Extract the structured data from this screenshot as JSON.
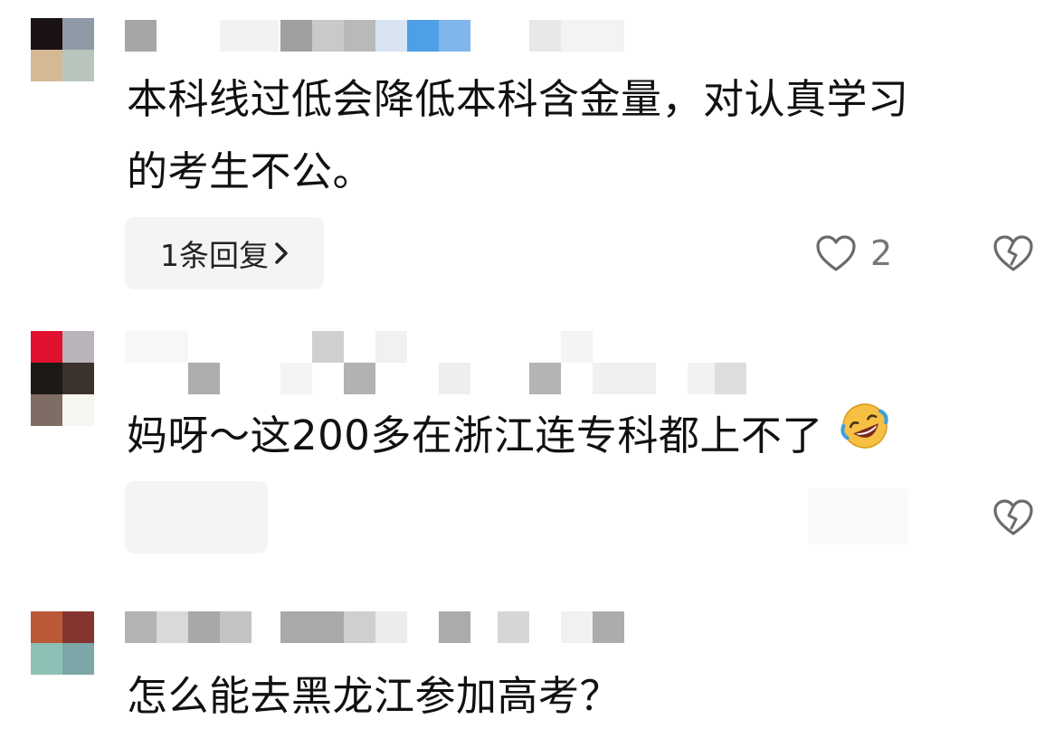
{
  "comments": [
    {
      "text_line1": "本科线过低会降低本科含金量，对认真学习",
      "text_line2": "的考生不公。",
      "reply_label": "1条回复",
      "like_count": "2",
      "avatar_colors": [
        "#1b1214",
        "#8e9aa6",
        "#d5b995",
        "#b7c5bd"
      ]
    },
    {
      "text": "妈呀～这200多在浙江连专科都上不了",
      "emoji": "rofl-emoji",
      "avatar_colors": [
        "#e0112f",
        "#b9b4b9",
        "#1d1a16",
        "#3b322b",
        "#7f6d65",
        "#f6f6f0"
      ]
    },
    {
      "text": "怎么能去黑龙江参加高考？",
      "avatar_colors": [
        "#bc5938",
        "#853530",
        "#8dc0b4",
        "#7ca6a8"
      ]
    }
  ],
  "colors": {
    "pill_bg": "#f3f4f5",
    "icon_stroke": "#6b6b6b",
    "count_text": "#777777"
  },
  "icons": [
    "heart-outline-icon",
    "broken-heart-icon",
    "chevron-right-icon"
  ]
}
